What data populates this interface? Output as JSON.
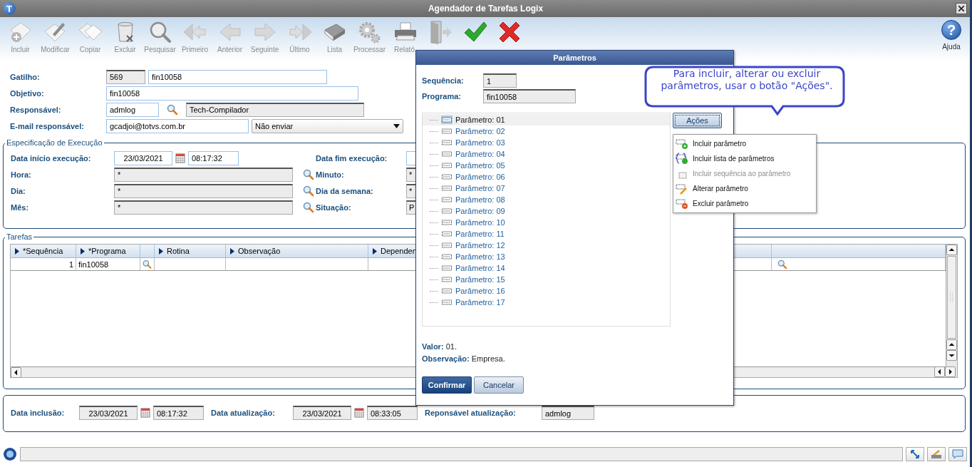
{
  "window": {
    "logo": "T",
    "title": "Agendador de Tarefas Logix"
  },
  "toolbar": [
    {
      "kind": "add",
      "label": "Incluir"
    },
    {
      "kind": "edit",
      "label": "Modificar"
    },
    {
      "kind": "copy",
      "label": "Copiar"
    },
    {
      "kind": "delete",
      "label": "Excluir"
    },
    {
      "kind": "search",
      "label": "Pesquisar"
    },
    {
      "kind": "first",
      "label": "Primeiro"
    },
    {
      "kind": "prev",
      "label": "Anterior"
    },
    {
      "kind": "next",
      "label": "Seguinte"
    },
    {
      "kind": "last",
      "label": "Último"
    },
    {
      "kind": "list",
      "label": "Lista"
    },
    {
      "kind": "process",
      "label": "Processar"
    },
    {
      "kind": "print",
      "label": "Relató"
    },
    {
      "kind": "exit"
    },
    {
      "kind": "confirm"
    },
    {
      "kind": "cancel"
    }
  ],
  "help": {
    "glyph": "?",
    "label": "Ajuda"
  },
  "gatilho": {
    "label": "Gatilho:",
    "code": "569",
    "name": "fin10058"
  },
  "objetivo": {
    "label": "Objetivo:",
    "value": "fin10058"
  },
  "responsavel": {
    "label": "Responsável:",
    "code": "admlog",
    "name": "Tech-Compilador"
  },
  "email": {
    "label": "E-mail responsável:",
    "value": "gcadjoi@totvs.com.br",
    "option": "Não enviar"
  },
  "execution": {
    "title": "Especificação de Execução",
    "start": {
      "label": "Data início execução:",
      "date": "23/03/2021",
      "time": "08:17:32"
    },
    "left_rows": [
      {
        "label": "Hora:",
        "value": "*"
      },
      {
        "label": "Dia:",
        "value": "*"
      },
      {
        "label": "Mês:",
        "value": "*"
      }
    ],
    "right_rows": [
      {
        "label": "Data fim execução:"
      },
      {
        "label": "Minuto:",
        "value": "*"
      },
      {
        "label": "Dia da semana:",
        "value": "*"
      },
      {
        "label": "Situação:",
        "value": "P"
      }
    ]
  },
  "tasks": {
    "title": "Tarefas",
    "columns": [
      "*Sequência",
      "*Programa",
      "Rotina",
      "Observação",
      "Dependen"
    ],
    "rows": [
      {
        "cells": [
          "1",
          "fin10058"
        ]
      }
    ]
  },
  "footer": {
    "inclusion": {
      "label": "Data inclusão:",
      "date": "23/03/2021",
      "time": "08:17:32"
    },
    "update": {
      "label": "Data atualização:",
      "date": "23/03/2021",
      "time": "08:33:05"
    },
    "updater": {
      "label": "Reponsável atualização:",
      "value": "admlog"
    }
  },
  "dialog": {
    "title": "Parâmetros",
    "sequence": {
      "label": "Sequência:",
      "value": "1"
    },
    "program": {
      "label": "Programa:",
      "value": "fin10058"
    },
    "tree": [
      {
        "label": "Parâmetro: 01",
        "selected": true
      },
      {
        "label": "Parâmetro: 02",
        "selected": false
      },
      {
        "label": "Parâmetro: 03",
        "selected": false
      },
      {
        "label": "Parâmetro: 04",
        "selected": false
      },
      {
        "label": "Parâmetro: 05",
        "selected": false
      },
      {
        "label": "Parâmetro: 06",
        "selected": false
      },
      {
        "label": "Parâmetro: 07",
        "selected": false
      },
      {
        "label": "Parâmetro: 08",
        "selected": false
      },
      {
        "label": "Parâmetro: 09",
        "selected": false
      },
      {
        "label": "Parâmetro: 10",
        "selected": false
      },
      {
        "label": "Parâmetro: 11",
        "selected": false
      },
      {
        "label": "Parâmetro: 12",
        "selected": false
      },
      {
        "label": "Parâmetro: 13",
        "selected": false
      },
      {
        "label": "Parâmetro: 14",
        "selected": false
      },
      {
        "label": "Parâmetro: 15",
        "selected": false
      },
      {
        "label": "Parâmetro: 16",
        "selected": false
      },
      {
        "label": "Parâmetro: 17",
        "selected": false
      }
    ],
    "actions_button": "Ações",
    "value": {
      "label": "Valor:",
      "text": "01."
    },
    "observation": {
      "label": "Observação:",
      "text": "Empresa."
    },
    "confirm": "Confirmar",
    "cancel": "Cancelar"
  },
  "actions_menu": [
    {
      "kind": "add",
      "label": "Incluir parâmetro",
      "disabled": false
    },
    {
      "kind": "list",
      "label": "Incluir lista de parâmetros",
      "disabled": false
    },
    {
      "kind": "sequence",
      "label": "Incluir sequência ao parâmetro",
      "disabled": true
    },
    {
      "kind": "edit",
      "label": "Alterar parâmetro",
      "disabled": false
    },
    {
      "kind": "delete",
      "label": "Excluir parâmetro",
      "disabled": false
    }
  ],
  "callout": {
    "text": "Para incluir, alterar ou excluir parâmetros, usar o botão \"Ações\"."
  }
}
